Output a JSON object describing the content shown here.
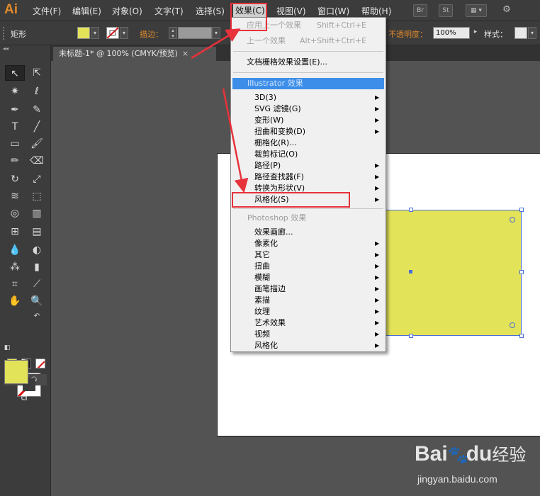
{
  "menubar": {
    "logo": "Ai",
    "items": [
      "文件(F)",
      "编辑(E)",
      "对象(O)",
      "文字(T)",
      "选择(S)",
      "效果(C)",
      "视图(V)",
      "窗口(W)",
      "帮助(H)"
    ],
    "active_index": 5,
    "right_buttons": [
      "Br",
      "St"
    ]
  },
  "control_bar": {
    "object_label": "矩形",
    "stroke_label": "描边：",
    "opacity_label": "不透明度：",
    "opacity_value": "100%",
    "style_label": "样式：",
    "fill_color": "#e3e35a"
  },
  "document_tab": {
    "title": "未标题-1* @ 100% (CMYK/预览)",
    "close": "×"
  },
  "effect_menu": {
    "apply_last": {
      "label": "应用上一个效果",
      "shortcut": "Shift+Ctrl+E"
    },
    "last_effect": {
      "label": "上一个效果",
      "shortcut": "Alt+Shift+Ctrl+E"
    },
    "raster_settings": "文档栅格效果设置(E)...",
    "illustrator_section": "Illustrator 效果",
    "illustrator_items": [
      "3D(3)",
      "SVG 滤镜(G)",
      "变形(W)",
      "扭曲和变换(D)",
      "栅格化(R)...",
      "裁剪标记(O)",
      "路径(P)",
      "路径查找器(F)",
      "转换为形状(V)",
      "风格化(S)"
    ],
    "photoshop_section": "Photoshop 效果",
    "photoshop_items": [
      "效果画廊...",
      "像素化",
      "其它",
      "扭曲",
      "模糊",
      "画笔描边",
      "素描",
      "纹理",
      "艺术效果",
      "视频",
      "风格化"
    ]
  },
  "watermark": {
    "brand_left": "Bai",
    "brand_right": "du",
    "brand_cn": "经验",
    "url": "jingyan.baidu.com"
  },
  "colors": {
    "accent_red": "#e8323c",
    "highlight_blue": "#3d8ee8",
    "selection_blue": "#4a6fd8",
    "ai_orange": "#e08a2a"
  }
}
